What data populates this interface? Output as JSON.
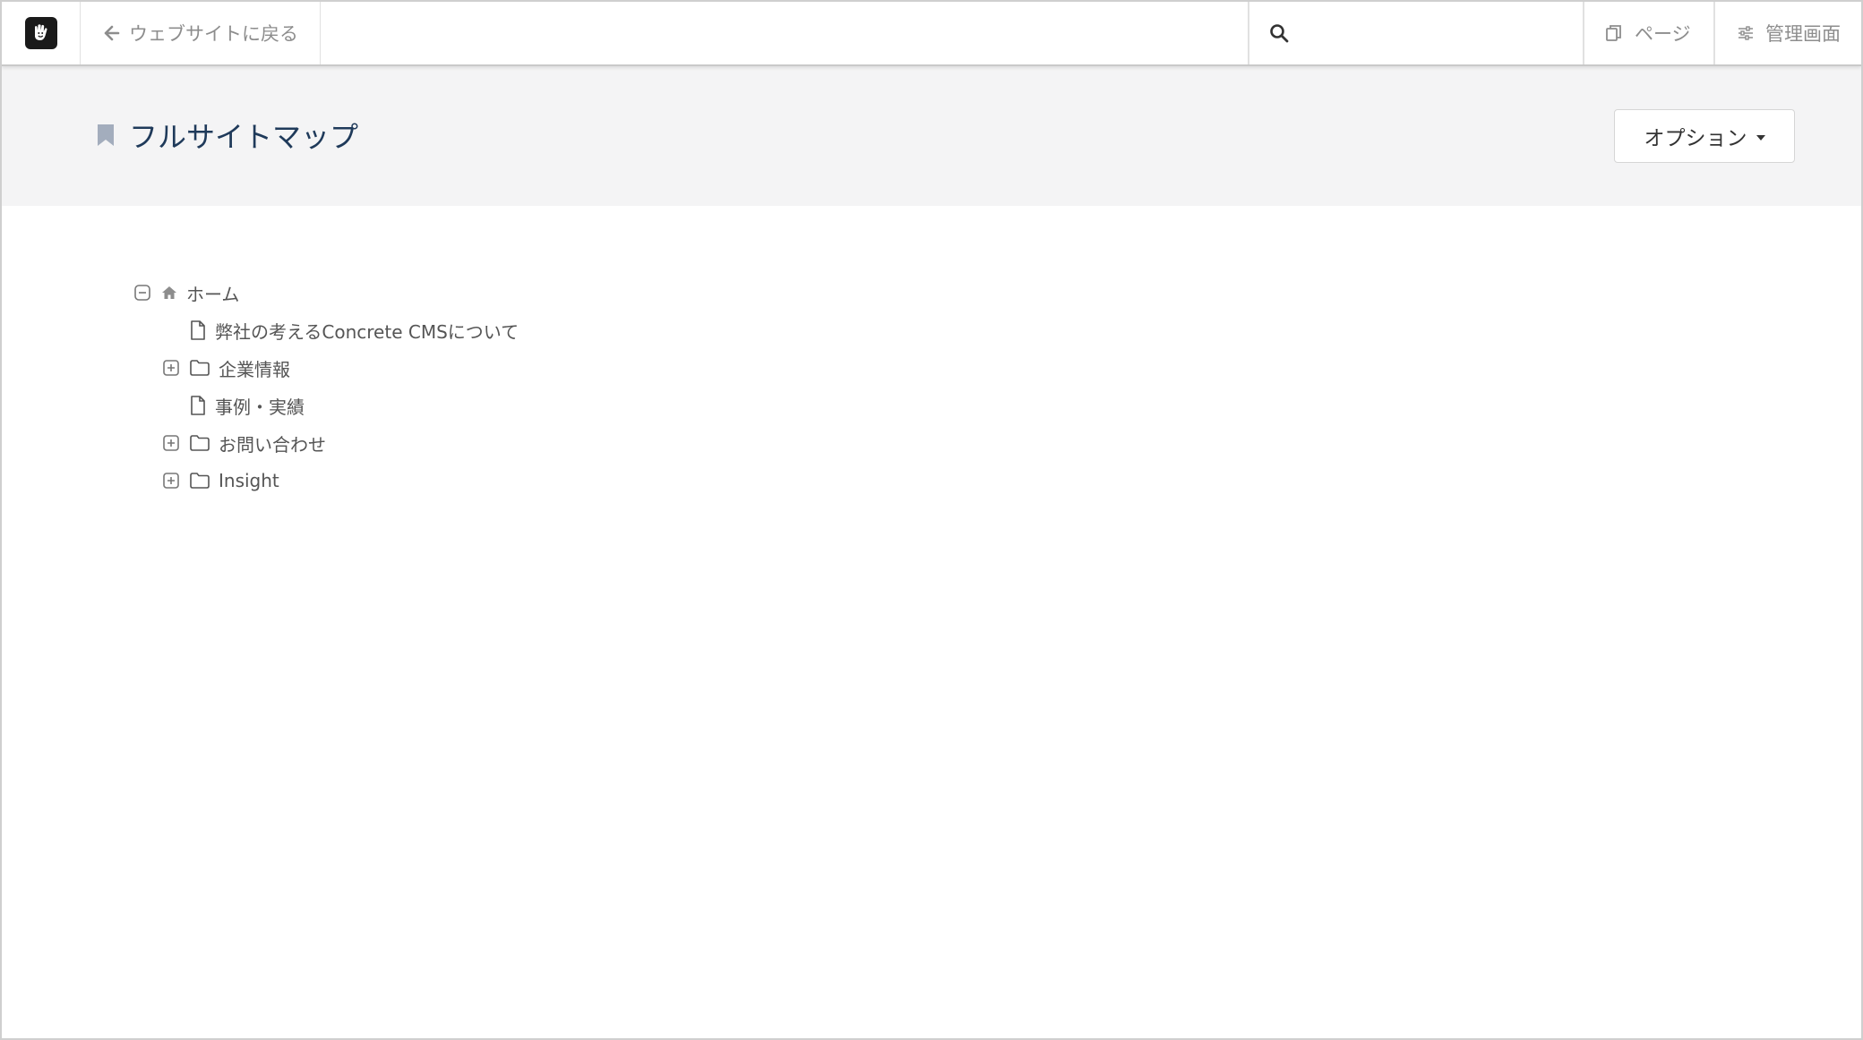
{
  "toolbar": {
    "logo_icon": "concrete-hand-icon",
    "back_label": "ウェブサイトに戻る",
    "search_placeholder": "",
    "page_label": "ページ",
    "admin_label": "管理画面"
  },
  "header": {
    "title": "フルサイトマップ",
    "options_label": "オプション"
  },
  "tree": {
    "root": {
      "label": "ホーム",
      "icon": "home-icon",
      "expanded": true
    },
    "children": [
      {
        "label": "弊社の考えるConcrete CMSについて",
        "icon": "page-icon",
        "has_children": false
      },
      {
        "label": "企業情報",
        "icon": "folder-icon",
        "has_children": true
      },
      {
        "label": "事例・実績",
        "icon": "page-icon",
        "has_children": false
      },
      {
        "label": "お問い合わせ",
        "icon": "folder-icon",
        "has_children": true
      },
      {
        "label": "Insight",
        "icon": "folder-icon",
        "has_children": true
      }
    ]
  },
  "colors": {
    "title": "#1f3a5a",
    "header_band": "#f4f4f5",
    "muted_text": "#8d8d8d"
  }
}
